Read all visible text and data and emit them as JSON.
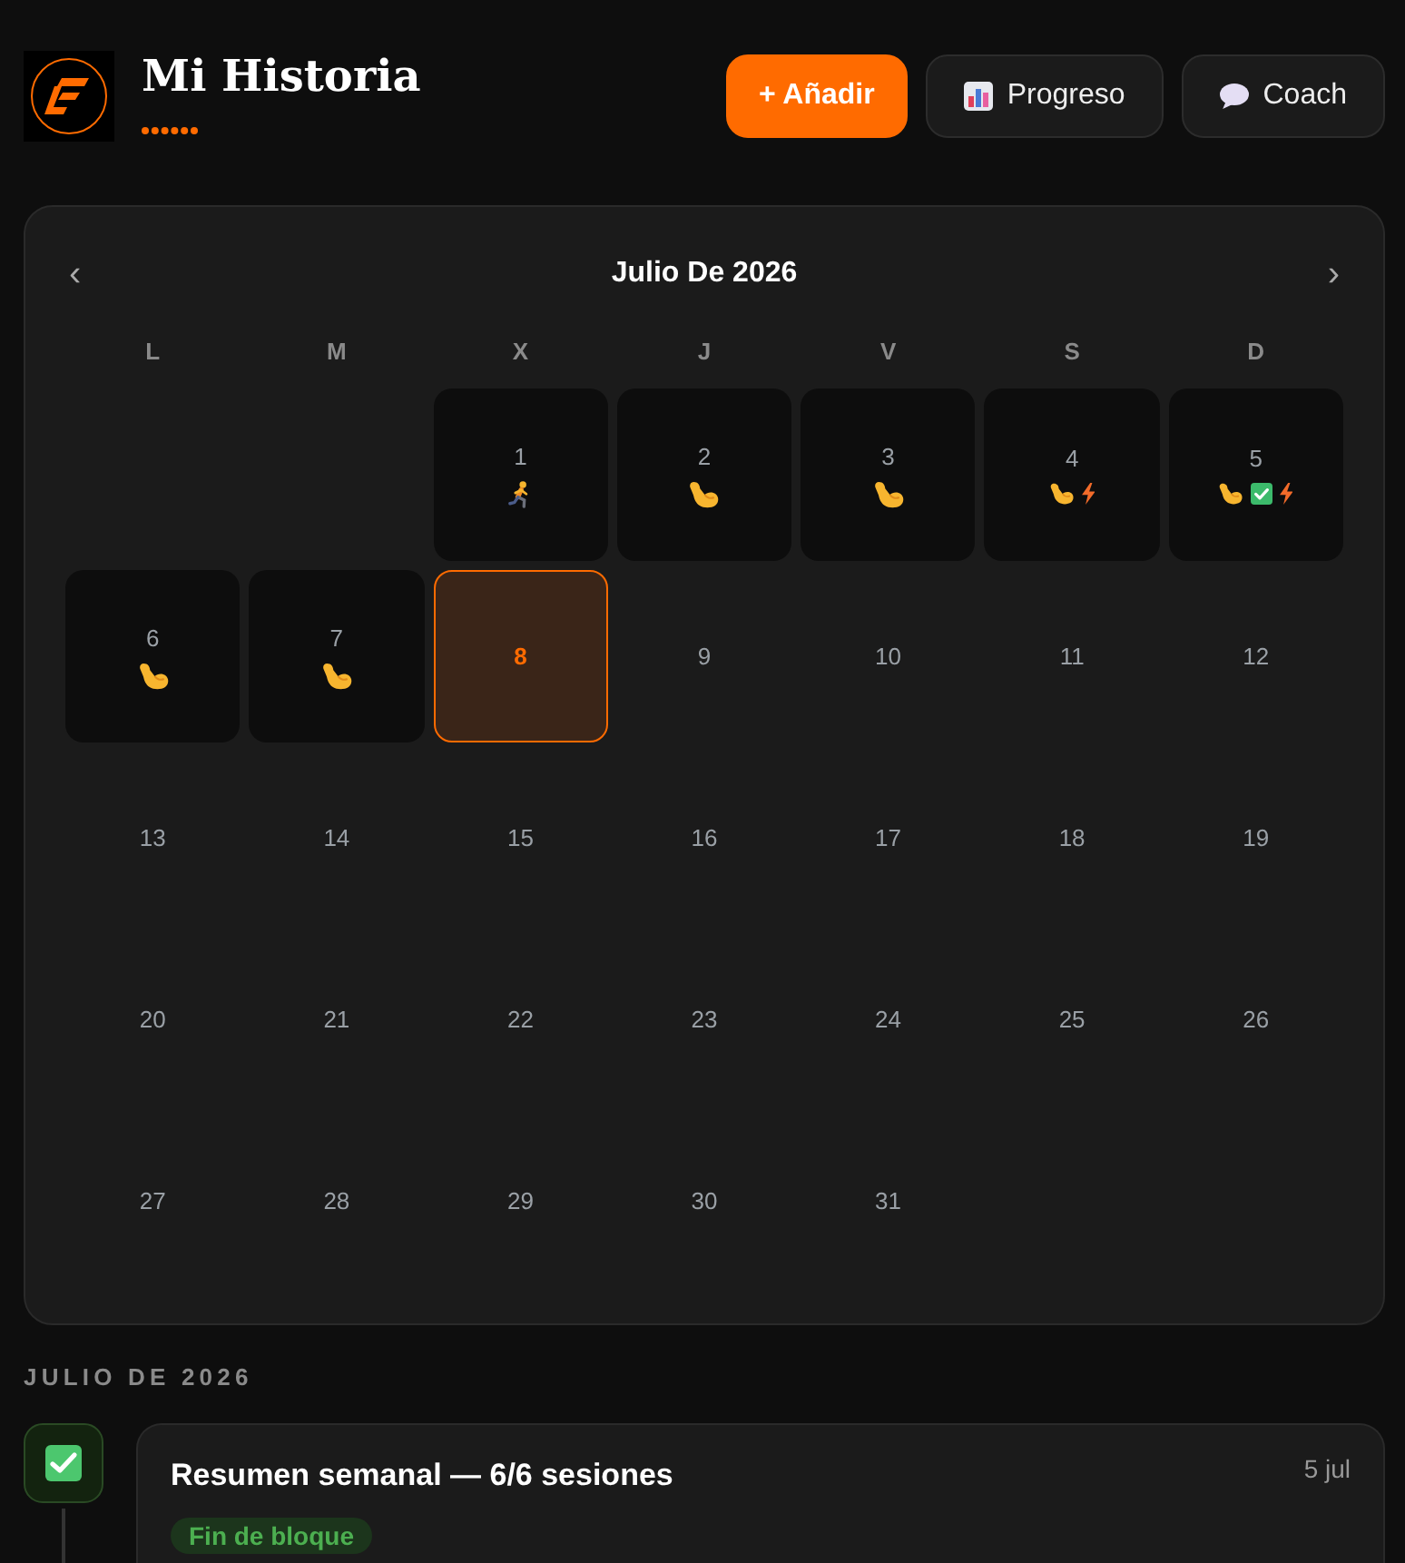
{
  "header": {
    "title": "Mi Historia",
    "buttons": [
      {
        "kind": "add",
        "label": "+ Añadir"
      },
      {
        "kind": "progress",
        "label": "Progreso"
      },
      {
        "kind": "coach",
        "label": "Coach"
      }
    ]
  },
  "calendar": {
    "prev": "‹",
    "title": "Julio De 2026",
    "next": "›",
    "weekdays": [
      "L",
      "M",
      "X",
      "J",
      "V",
      "S",
      "D"
    ],
    "weeks": [
      {
        "days": [
          {
            "day": "1",
            "today": false,
            "activities": [
              {
                "kind": "run"
              }
            ]
          },
          {
            "day": "2",
            "today": false,
            "activities": [
              {
                "kind": "strength"
              }
            ]
          },
          {
            "day": "3",
            "today": false,
            "activities": [
              {
                "kind": "strength"
              }
            ]
          },
          {
            "day": "4",
            "today": false,
            "activities": [
              {
                "kind": "strength"
              },
              {
                "kind": "bolt"
              }
            ]
          },
          {
            "day": "5",
            "today": false,
            "activities": [
              {
                "kind": "strength"
              },
              {
                "kind": "check"
              },
              {
                "kind": "bolt"
              }
            ]
          }
        ]
      },
      {
        "days": [
          {
            "day": "6",
            "today": false,
            "activities": [
              {
                "kind": "strength"
              }
            ]
          },
          {
            "day": "7",
            "today": false,
            "activities": [
              {
                "kind": "strength"
              }
            ]
          },
          {
            "day": "8",
            "today": true
          },
          {
            "day": "9",
            "today": false
          },
          {
            "day": "10",
            "today": false
          },
          {
            "day": "11",
            "today": false
          },
          {
            "day": "12",
            "today": false
          }
        ]
      },
      {
        "days": [
          {
            "day": "13",
            "today": false
          },
          {
            "day": "14",
            "today": false
          },
          {
            "day": "15",
            "today": false
          },
          {
            "day": "16",
            "today": false
          },
          {
            "day": "17",
            "today": false
          },
          {
            "day": "18",
            "today": false
          },
          {
            "day": "19",
            "today": false
          }
        ]
      },
      {
        "days": [
          {
            "day": "20",
            "today": false
          },
          {
            "day": "21",
            "today": false
          },
          {
            "day": "22",
            "today": false
          },
          {
            "day": "23",
            "today": false
          },
          {
            "day": "24",
            "today": false
          },
          {
            "day": "25",
            "today": false
          },
          {
            "day": "26",
            "today": false
          }
        ]
      },
      {
        "days": [
          {
            "day": "27",
            "today": false
          },
          {
            "day": "28",
            "today": false
          },
          {
            "day": "29",
            "today": false
          },
          {
            "day": "30",
            "today": false
          },
          {
            "day": "31",
            "today": false
          }
        ]
      }
    ]
  },
  "history": {
    "heading": "JULIO DE 2026",
    "entries": [
      {
        "kind": "check",
        "title": "Resumen semanal — 6/6 sesiones",
        "date": "5 jul",
        "tag": "Fin de bloque"
      }
    ]
  }
}
